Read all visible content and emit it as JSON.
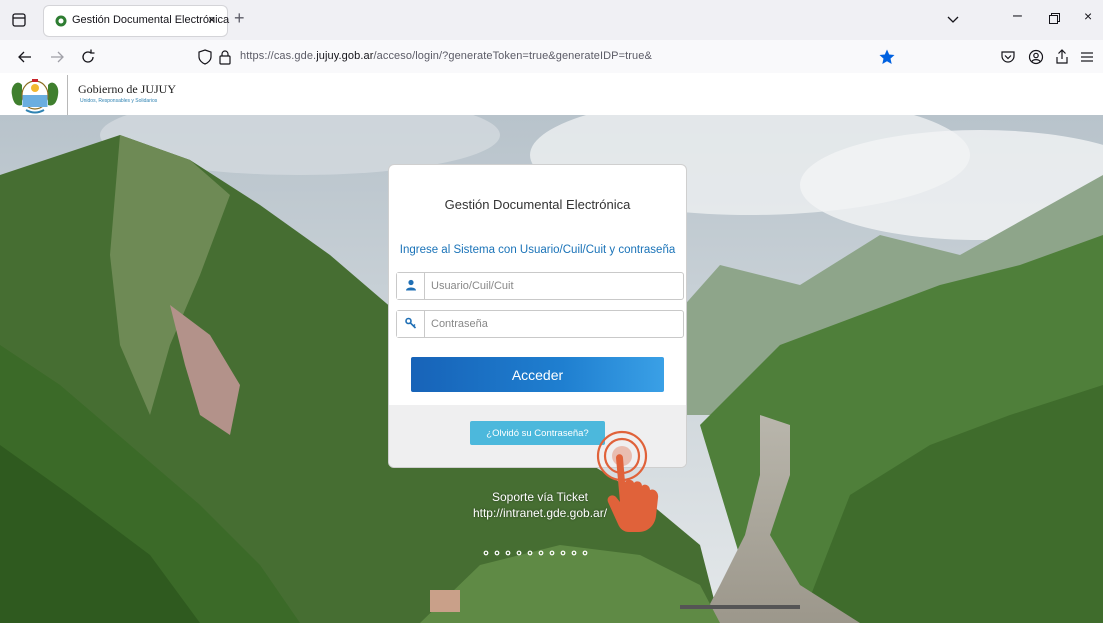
{
  "browser": {
    "tab_title": "Gestión Documental Electrónica",
    "tab_close": "×",
    "new_tab": "+",
    "url_prefix": "https://cas.gde.",
    "url_domain": "jujuy.gob.ar",
    "url_suffix": "/acceso/login/?generateToken=true&generateIDP=true&",
    "minimize": "–",
    "close": "×"
  },
  "site": {
    "title": "Gobierno de JUJUY",
    "subtitle": "Unidos, Responsables y Solidarios"
  },
  "login": {
    "title": "Gestión Documental Electrónica",
    "subtitle": "Ingrese al Sistema con Usuario/Cuil/Cuit y contraseña",
    "username_placeholder": "Usuario/Cuil/Cuit",
    "password_placeholder": "Contraseña",
    "submit_label": "Acceder",
    "forgot_label": "¿Olvidó su Contraseña?"
  },
  "support": {
    "line1": "Soporte vía Ticket",
    "line2": "http://intranet.gde.gob.ar/"
  },
  "colors": {
    "accent": "#1a73b8",
    "button_primary": "#1f7fd0",
    "button_secondary": "#4cb8dc",
    "bookmark_star": "#0061e0",
    "pointer_hand": "#e0623a"
  }
}
